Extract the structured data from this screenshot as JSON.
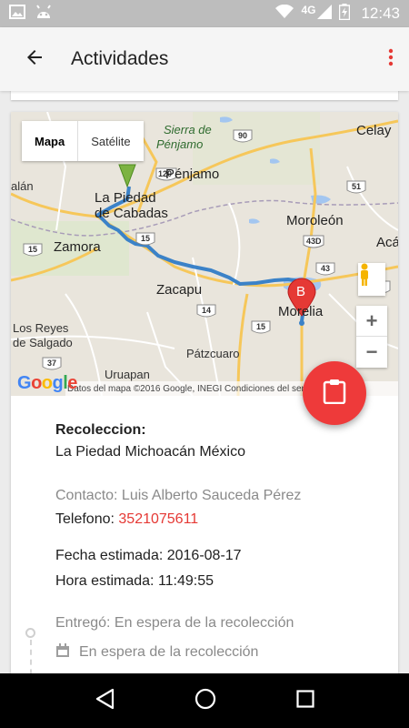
{
  "status_bar": {
    "network": "4G",
    "time": "12:43",
    "icons": [
      "image-icon",
      "android-icon",
      "wifi-icon",
      "signal-icon",
      "battery-icon"
    ]
  },
  "app_bar": {
    "title": "Actividades",
    "back_icon": "arrow-back-icon",
    "menu_icon": "more-vert-icon",
    "menu_color": "#e53935"
  },
  "map": {
    "type_buttons": [
      "Mapa",
      "Satélite"
    ],
    "selected_type": "Mapa",
    "marker_b_label": "B",
    "labels": {
      "sierra": "Sierra de",
      "penjamo_region": "Pénjamo",
      "penjamo": "Pénjamo",
      "celaya": "Celay",
      "la_piedad_1": "La Piedad",
      "la_piedad_2": "de Cabadas",
      "moroleon": "Moroleón",
      "acambaro": "Acár",
      "zamora": "Zamora",
      "zacapu": "Zacapu",
      "morelia": "Morelia",
      "los_reyes_1": "Los Reyes",
      "los_reyes_2": "de Salgado",
      "patzcuaro": "Pátzcuaro",
      "uruapan": "Uruapan",
      "alan": "alán"
    },
    "road_shields": [
      "90",
      "51",
      "43",
      "43D",
      "15",
      "15",
      "15",
      "14",
      "37",
      "120",
      "2"
    ],
    "zoom_in": "+",
    "zoom_out": "−",
    "logo": "Google",
    "attribution": "Datos del mapa ©2016 Google, INEGI     Condiciones del servicio",
    "accent_route": "#3b82c8",
    "marker_colors": {
      "origin": "#7cb342",
      "destination": "#e53935"
    }
  },
  "fab": {
    "icon": "clipboard-icon",
    "color": "#ee3a3a"
  },
  "details": {
    "pickup_label": "Recoleccion:",
    "pickup_address": "La Piedad Michoacán México",
    "contact": "Contacto: Luis Alberto Sauceda Pérez",
    "phone_label": "Telefono: ",
    "phone_value": "3521075611",
    "date": "Fecha estimada: 2016-08-17",
    "time": "Hora estimada: 11:49:55",
    "delivered": "Entregó: En espera de la recolección",
    "status": "En espera de la recolección"
  },
  "nav_bar": {
    "icons": [
      "back-triangle-icon",
      "home-circle-icon",
      "recents-square-icon"
    ]
  }
}
